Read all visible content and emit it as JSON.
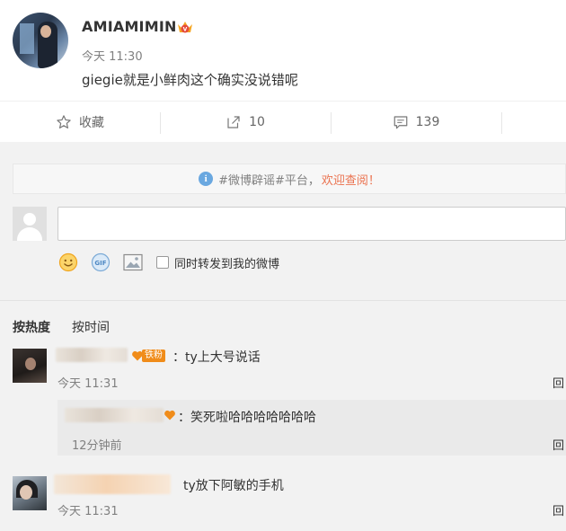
{
  "post": {
    "username": "AMIAMIMIN",
    "time": "今天 11:30",
    "text": "giegie就是小鲜肉这个确实没说错呢"
  },
  "actions": {
    "favorite": "收藏",
    "repost_count": "10",
    "comment_count": "139"
  },
  "notice": {
    "prefix": "#微博辟谣#平台，",
    "link": "欢迎查阅！"
  },
  "composer": {
    "input_value": "",
    "forward_label": "同时转发到我的微博",
    "forward_checked": false
  },
  "sort": {
    "hot": "按热度",
    "time": "按时间"
  },
  "comments": [
    {
      "badge": "铁粉",
      "text": "：ty上大号说话",
      "time": "今天 11:31",
      "reply": "回",
      "sub_reply": {
        "text": "：笑死啦哈哈哈哈哈哈哈",
        "time": "12分钟前",
        "reply": "回"
      }
    },
    {
      "text": "ty放下阿敏的手机",
      "time": "今天 11:31",
      "reply": "回"
    }
  ],
  "icons": {
    "favorite": "star-icon",
    "repost": "repost-arrow-icon",
    "comment": "comment-bubble-icon",
    "emoji": "emoji-icon",
    "gif": "gif-icon",
    "image": "image-icon",
    "info": "info-icon"
  },
  "colors": {
    "accent_orange": "#eb7350",
    "fan_badge": "#f08c1a",
    "info_blue": "#6aa8e0"
  }
}
